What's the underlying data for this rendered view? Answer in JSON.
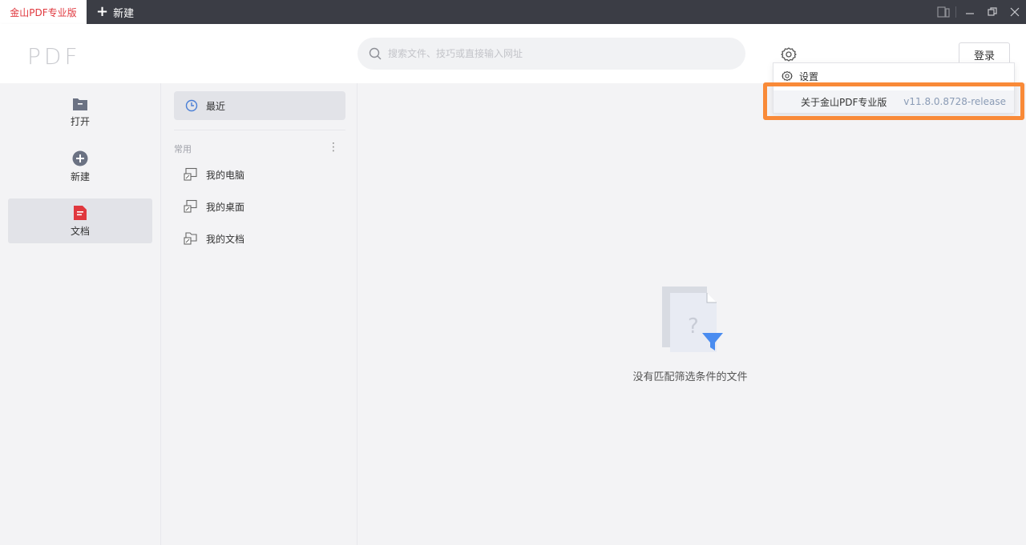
{
  "titlebar": {
    "active_tab": "金山PDF专业版",
    "new_tab_label": "新建"
  },
  "header": {
    "logo": "PDF",
    "search_placeholder": "搜索文件、技巧或直接输入网址",
    "login_label": "登录"
  },
  "dropdown": {
    "settings_label": "设置",
    "about_label": "关于金山PDF专业版",
    "version": "v11.8.0.8728-release"
  },
  "leftnav": {
    "items": [
      {
        "label": "打开",
        "icon": "folder-icon"
      },
      {
        "label": "新建",
        "icon": "plus-circle-icon"
      },
      {
        "label": "文档",
        "icon": "document-icon",
        "active": true
      }
    ]
  },
  "midpanel": {
    "recent_label": "最近",
    "section_label": "常用",
    "locations": [
      {
        "label": "我的电脑",
        "icon": "computer-icon"
      },
      {
        "label": "我的桌面",
        "icon": "desktop-icon"
      },
      {
        "label": "我的文档",
        "icon": "documents-folder-icon"
      }
    ]
  },
  "main": {
    "empty_text": "没有匹配筛选条件的文件"
  },
  "colors": {
    "brand_red": "#e0383e",
    "highlight_orange": "#f98a38",
    "filter_blue": "#4a8cf0"
  }
}
